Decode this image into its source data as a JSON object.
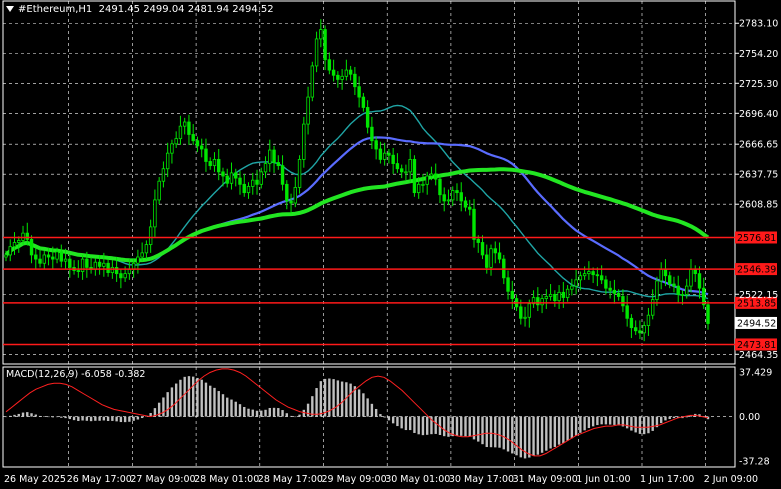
{
  "header": {
    "symbol": "#Ethereum,H1",
    "ohlc": "2491.45 2499.04 2481.94 2494.52"
  },
  "macd": {
    "label": "MACD(12,26,9) -6.058 -0.382",
    "axis_labels": [
      "37.429",
      "0.00",
      "-37.28"
    ]
  },
  "price_axis": {
    "labels": [
      "2783.10",
      "2754.20",
      "2725.30",
      "2696.40",
      "2666.65",
      "2637.75",
      "2608.85",
      "2522.15",
      "2464.35"
    ],
    "min": 2455.0,
    "max": 2792.0
  },
  "current_price": "2494.52",
  "levels": [
    {
      "price": 2576.81,
      "label": "2576.81",
      "color": "#ff1a1a"
    },
    {
      "price": 2546.39,
      "label": "2546.39",
      "color": "#ff1a1a"
    },
    {
      "price": 2513.85,
      "label": "2513.85",
      "color": "#ff1a1a"
    },
    {
      "price": 2473.81,
      "label": "2473.81",
      "color": "#ff1a1a"
    }
  ],
  "time_axis": [
    "26 May 2025",
    "26 May 17:00",
    "27 May 09:00",
    "28 May 01:00",
    "28 May 17:00",
    "29 May 09:00",
    "30 May 01:00",
    "30 May 17:00",
    "31 May 09:00",
    "1 Jun 01:00",
    "1 Jun 17:00",
    "2 Jun 09:00"
  ],
  "colors": {
    "background": "#000000",
    "candles": "#00e600",
    "grid": "#ffffff",
    "ma_fast": "#1fa5a5",
    "ma_mid": "#5a6cff",
    "ma_slow": "#22e622",
    "macd_hist": "#c0c0c0",
    "macd_signal": "#ff2020"
  },
  "chart_data": {
    "type": "candlestick",
    "close": [
      2560,
      2568,
      2572,
      2574,
      2581,
      2575,
      2560,
      2556,
      2552,
      2560,
      2558,
      2556,
      2563,
      2554,
      2556,
      2548,
      2545,
      2544,
      2556,
      2548,
      2546,
      2553,
      2549,
      2552,
      2543,
      2548,
      2542,
      2538,
      2542,
      2546,
      2552,
      2558,
      2562,
      2570,
      2587,
      2613,
      2631,
      2643,
      2658,
      2667,
      2672,
      2684,
      2688,
      2676,
      2670,
      2665,
      2662,
      2650,
      2646,
      2652,
      2640,
      2636,
      2629,
      2639,
      2634,
      2628,
      2620,
      2626,
      2632,
      2628,
      2640,
      2648,
      2661,
      2649,
      2646,
      2628,
      2612,
      2610,
      2625,
      2652,
      2686,
      2712,
      2742,
      2768,
      2777,
      2748,
      2738,
      2733,
      2729,
      2732,
      2738,
      2734,
      2722,
      2712,
      2702,
      2683,
      2670,
      2662,
      2652,
      2658,
      2656,
      2648,
      2643,
      2640,
      2640,
      2652,
      2620,
      2628,
      2628,
      2636,
      2638,
      2633,
      2618,
      2612,
      2613,
      2622,
      2620,
      2612,
      2606,
      2604,
      2575,
      2572,
      2560,
      2548,
      2566,
      2562,
      2556,
      2538,
      2525,
      2518,
      2510,
      2499,
      2500,
      2513,
      2519,
      2512,
      2518,
      2520,
      2522,
      2516,
      2524,
      2519,
      2527,
      2530,
      2536,
      2540,
      2542,
      2544,
      2541,
      2540,
      2536,
      2528,
      2526,
      2523,
      2520,
      2511,
      2499,
      2490,
      2487,
      2485,
      2492,
      2502,
      2517,
      2535,
      2546,
      2540,
      2532,
      2530,
      2522,
      2522,
      2530,
      2546,
      2542,
      2528,
      2512,
      2494
    ],
    "macd_signal": [
      4,
      8,
      12,
      16,
      20,
      23,
      25,
      27,
      28,
      28,
      27,
      25,
      22,
      19,
      16,
      13,
      10,
      8,
      6,
      5,
      4,
      3,
      2,
      1,
      0,
      1,
      3,
      6,
      10,
      15,
      20,
      25,
      30,
      34,
      37,
      39,
      40,
      40,
      39,
      37,
      34,
      30,
      26,
      22,
      18,
      14,
      11,
      8,
      6,
      4,
      3,
      2,
      2,
      3,
      5,
      8,
      12,
      17,
      22,
      26,
      30,
      33,
      34,
      33,
      30,
      26,
      22,
      17,
      12,
      7,
      2,
      -3,
      -7,
      -11,
      -14,
      -16,
      -17,
      -17,
      -16,
      -15,
      -14,
      -14,
      -15,
      -17,
      -20,
      -24,
      -28,
      -31,
      -33,
      -33,
      -31,
      -28,
      -25,
      -22,
      -19,
      -16,
      -14,
      -12,
      -10,
      -9,
      -8,
      -8,
      -7,
      -7,
      -8,
      -9,
      -9,
      -9,
      -8,
      -7,
      -5,
      -3,
      -1,
      0,
      1,
      1,
      0,
      -1
    ]
  }
}
